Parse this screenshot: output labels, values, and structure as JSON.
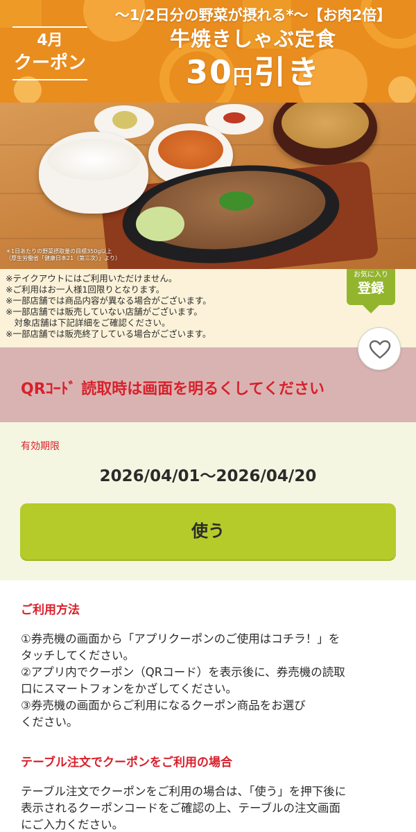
{
  "banner": {
    "month_label": "4月",
    "coupon_label": "クーポン",
    "subtitle": "〜1/2日分の野菜が摂れる*〜【お肉2倍】",
    "product_name": "牛焼きしゃぶ定食",
    "discount_amount": "30",
    "discount_unit": "円",
    "discount_suffix": "引き"
  },
  "photo": {
    "note_line1": "＊1日あたりの野菜摂取量の目標350g以上",
    "note_line2": "（厚生労働省「健康日本21（第三次）」より）"
  },
  "notes": [
    "※テイクアウトにはご利用いただけません。",
    "※ご利用はお一人様1回限りとなります。",
    "※一部店舗では商品内容が異なる場合がございます。",
    "※一部店舗では販売していない店舗がございます。",
    "　対象店舗は下記詳細をご確認ください。",
    "※一部店舗では販売終了している場合がございます。"
  ],
  "favorite": {
    "label_small": "お気に入り",
    "label_large": "登録",
    "icon": "heart-icon"
  },
  "qr_notice": {
    "text": "QRｺｰﾄﾞ 読取時は画面を明るくしてください",
    "color": "#d8202b"
  },
  "validity": {
    "label": "有効期限",
    "range": "2026/04/01〜2026/04/20"
  },
  "use_button": {
    "label": "使う",
    "color": "#b4cb2a"
  },
  "how_to_use": {
    "title": "ご利用方法",
    "lines": [
      "①券売機の画面から「アプリクーポンのご使用はコチラ！」を",
      "タッチしてください。",
      "②アプリ内でクーポン（QRコード）を表示後に、券売機の読取",
      "口にスマートフォンをかざしてください。",
      "③券売機の画面からご利用になるクーポン商品をお選び",
      "ください。"
    ]
  },
  "table_order": {
    "title": "テーブル注文でクーポンをご利用の場合",
    "lines": [
      "テーブル注文でクーポンをご利用の場合は、「使う」を押下後に",
      "表示されるクーポンコードをご確認の上、テーブルの注文画面",
      "にご入力ください。"
    ]
  }
}
